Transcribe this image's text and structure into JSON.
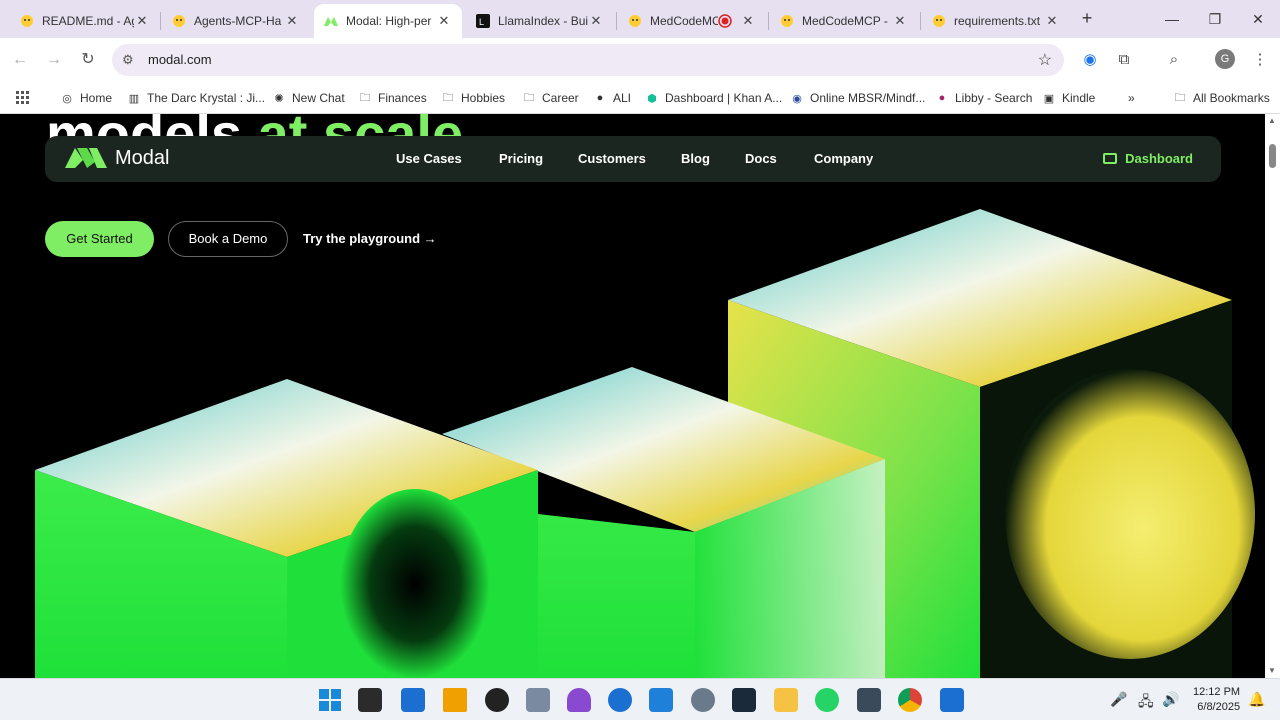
{
  "browser": {
    "tabs": [
      {
        "title": "README.md - Ag",
        "active": false
      },
      {
        "title": "Agents-MCP-Ha",
        "active": false
      },
      {
        "title": "Modal: High-per",
        "active": true
      },
      {
        "title": "LlamaIndex - Bui",
        "active": false
      },
      {
        "title": "MedCodeMC",
        "active": false
      },
      {
        "title": "MedCodeMCP -",
        "active": false
      },
      {
        "title": "requirements.txt",
        "active": false
      }
    ],
    "url": "modal.com",
    "bookmarks": [
      "Home",
      "The Darc Krystal : Ji...",
      "New Chat",
      "Finances",
      "Hobbies",
      "Career",
      "ALI",
      "Dashboard | Khan A...",
      "Online MBSR/Mindf...",
      "Libby - Search",
      "Kindle"
    ],
    "all_bookmarks": "All Bookmarks",
    "profile_initial": "G"
  },
  "page": {
    "hero_clip": {
      "text": "models ",
      "accent": "at scale"
    },
    "logo": "Modal",
    "nav": [
      "Use Cases",
      "Pricing",
      "Customers",
      "Blog",
      "Docs",
      "Company"
    ],
    "dashboard": "Dashboard",
    "cta": {
      "primary": "Get Started",
      "secondary": "Book a Demo",
      "link": "Try the playground",
      "link_arrow": "→"
    }
  },
  "taskbar": {
    "time": "12:12 PM",
    "date": "6/8/2025"
  },
  "colors": {
    "accent": "#7fee64",
    "nav_bg": "#1c2621"
  }
}
